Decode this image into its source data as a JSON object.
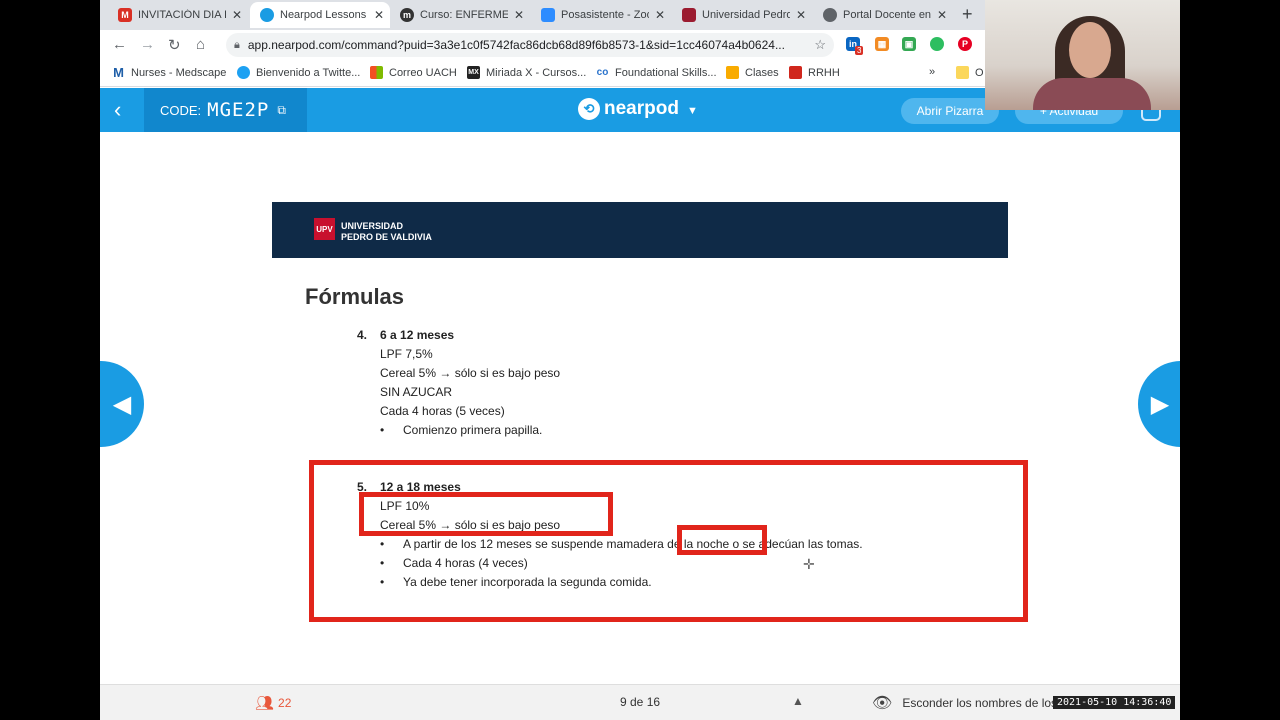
{
  "browser": {
    "tabs": [
      {
        "title": "INVITACIÓN DIA IN",
        "icon": "gmail-icon",
        "color": "#d93025",
        "glyph": "M"
      },
      {
        "title": "Nearpod Lessons",
        "icon": "nearpod-icon",
        "color": "#1a9ce3",
        "glyph": ""
      },
      {
        "title": "Curso: ENFERMER",
        "icon": "moodle-icon",
        "color": "#333333",
        "glyph": "m"
      },
      {
        "title": "Posasistente - Zoo",
        "icon": "zoom-icon",
        "color": "#2d8cff",
        "glyph": ""
      },
      {
        "title": "Universidad Pedro",
        "icon": "upv-icon",
        "color": "#9b1b30",
        "glyph": ""
      },
      {
        "title": "Portal Docente en",
        "icon": "globe-icon",
        "color": "#5f6368",
        "glyph": ""
      }
    ],
    "url": "app.nearpod.com/command?puid=3a3e1c0f5742fac86dcb68d89f6b8573-1&sid=1cc46074a4b0624...",
    "extension_badge": "3",
    "bookmarks": [
      {
        "label": "Nurses - Medscape",
        "icon": "medscape-icon",
        "color": "#1f5fa8",
        "glyph": "M"
      },
      {
        "label": "Bienvenido a Twitte...",
        "icon": "twitter-icon",
        "color": "#1da1f2",
        "glyph": ""
      },
      {
        "label": "Correo UACH",
        "icon": "microsoft-icon",
        "color": "#f25022",
        "glyph": ""
      },
      {
        "label": "Miriada X - Cursos...",
        "icon": "miriadax-icon",
        "color": "#222222",
        "glyph": "MX"
      },
      {
        "label": "Foundational Skills...",
        "icon": "coursera-icon",
        "color": "#2a73cc",
        "glyph": "co"
      },
      {
        "label": "Clases",
        "icon": "classroom-icon",
        "color": "#f9ab00",
        "glyph": ""
      },
      {
        "label": "RRHH",
        "icon": "adp-icon",
        "color": "#d0271d",
        "glyph": ""
      }
    ],
    "bookmarks_more": "»",
    "other_bookmarks": "O"
  },
  "nearpod": {
    "code_label": "CODE:",
    "code": "MGE2P",
    "brand": "nearpod",
    "whiteboard_button": "Abrir Pizarra",
    "activity_button": "+ Actividad"
  },
  "slide": {
    "institution_line1": "UNIVERSIDAD",
    "institution_line2": "PEDRO DE VALDIVIA",
    "logo_text": "UPV",
    "title": "Fórmulas",
    "section4": {
      "number": "4.",
      "heading": "6 a 12 meses",
      "lines": [
        "LPF 7,5%",
        "Cereal 5% → sólo si es bajo peso",
        "SIN AZUCAR",
        "Cada 4 horas (5 veces)"
      ],
      "bullets": [
        "Comienzo primera papilla."
      ]
    },
    "section5": {
      "number": "5.",
      "heading": "12 a 18 meses",
      "lines": [
        "LPF 10%",
        "Cereal 5% → sólo si es bajo peso"
      ],
      "bullets": [
        "A partir de los 12 meses se suspende mamadera de la noche o se adecúan las tomas.",
        "Cada 4 horas (4 veces)",
        "Ya debe tener incorporada la segunda comida."
      ]
    },
    "annotation_color": "#e1251b"
  },
  "footer": {
    "students_count": "22",
    "page_indicator": "9 de 16",
    "hide_names_label": "Esconder los nombres de los estudiantes"
  },
  "timestamp": "2021-05-10 14:36:40"
}
